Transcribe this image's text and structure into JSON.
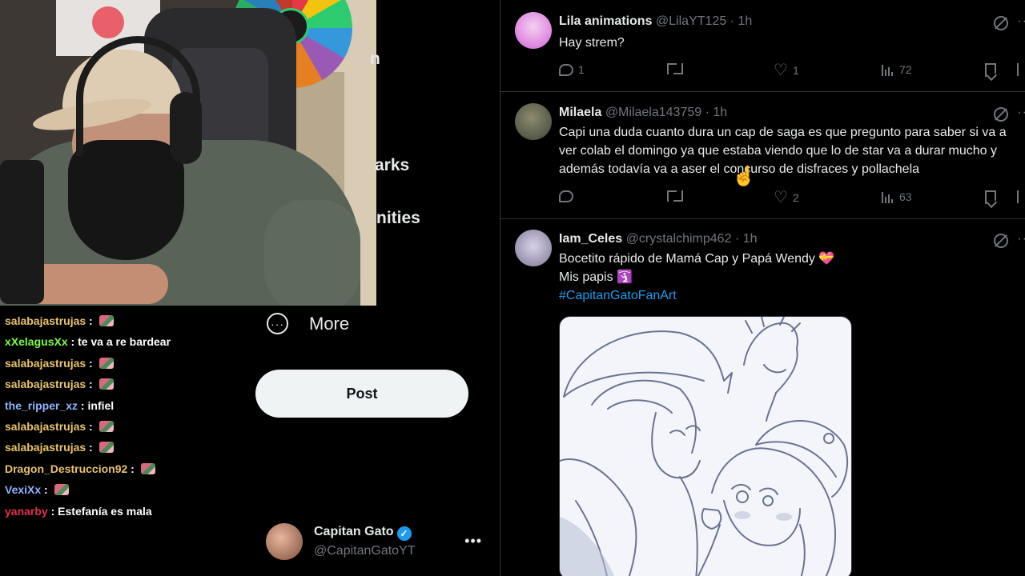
{
  "chat": {
    "messages": [
      {
        "user": "salabajastrujas",
        "color": "#e9c46a",
        "text": "",
        "emote": true
      },
      {
        "user": "xXelagusXx",
        "color": "#7cfc4a",
        "text": "te va a re bardear",
        "emote": false
      },
      {
        "user": "salabajastrujas",
        "color": "#e9c46a",
        "text": "",
        "emote": true
      },
      {
        "user": "salabajastrujas",
        "color": "#e9c46a",
        "text": "",
        "emote": true
      },
      {
        "user": "the_ripper_xz",
        "color": "#8fb4ff",
        "text": "infiel",
        "emote": false
      },
      {
        "user": "salabajastrujas",
        "color": "#e9c46a",
        "text": "",
        "emote": true
      },
      {
        "user": "salabajastrujas",
        "color": "#e9c46a",
        "text": "",
        "emote": true
      },
      {
        "user": "Dragon_Destruccion92",
        "color": "#e9c46a",
        "text": "",
        "emote": true
      },
      {
        "user": "VexiXx",
        "color": "#8fb4ff",
        "text": "",
        "emote": true
      },
      {
        "user": "yanarby",
        "color": "#e0314b",
        "text": "Estefanía es mala",
        "emote": false
      }
    ]
  },
  "nav": {
    "frag1": "n",
    "frag2": "arks",
    "frag3": "nities",
    "more_label": "More",
    "post_label": "Post"
  },
  "account": {
    "name": "Capitan Gato",
    "handle": "@CapitanGatoYT",
    "verified_mark": "✓"
  },
  "tweets": [
    {
      "name": "Lila animations",
      "handle": "@LilaYT125",
      "time": "1h",
      "text": "Hay strem?",
      "replies": "1",
      "retweets": "",
      "likes": "1",
      "views": "72",
      "avatar_color": "#d264d8"
    },
    {
      "name": "Milaela",
      "handle": "@Milaela143759",
      "time": "1h",
      "text": "Capi una duda cuanto dura un cap de saga es que pregunto para saber si va a ver colab el domingo ya que estaba viendo que lo de star va a durar mucho y además todavía va a aser el concurso de disfraces y pollachela",
      "replies": "",
      "retweets": "",
      "likes": "2",
      "views": "63",
      "avatar_color": "#5b6650"
    },
    {
      "name": "Iam_Celes",
      "handle": "@crystalchimp462",
      "time": "1h",
      "line1": "Bocetito rápido de Mamá Cap y Papá Wendy",
      "line1_emoji": "💝",
      "line2": "Mis papis",
      "line2_emoji": "🛐",
      "hashtag": "#CapitanGatoFanArt",
      "avatar_color": "#9f99b5"
    }
  ],
  "colors": {
    "accent": "#1d9bf0",
    "muted": "#71767b",
    "text": "#e7e9ea",
    "divider": "#2f3336"
  }
}
